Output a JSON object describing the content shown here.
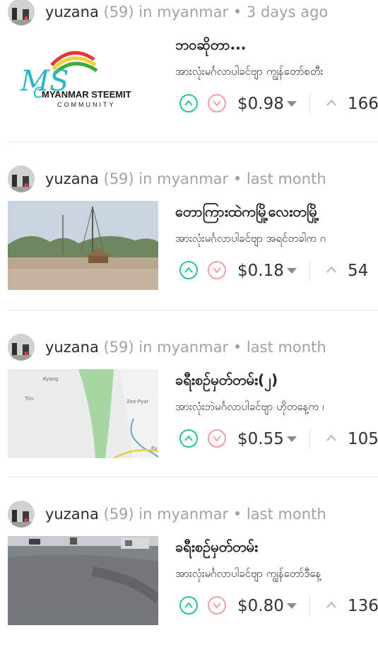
{
  "posts": [
    {
      "author": "yuzana",
      "reputation": "(59)",
      "in": "in",
      "community": "myanmar",
      "time": "3 days ago",
      "title": "ဘဝဆိုတာ...",
      "excerpt": "အားလုံးမင်္ဂလာပါခင်ဗျာ ကျွန်တော်စတီး",
      "payout": "$0.98",
      "votes": "166",
      "thumb_logo": "MYANMAR STEEMIT",
      "thumb_logo_sub": "COMMUNITY"
    },
    {
      "author": "yuzana",
      "reputation": "(59)",
      "in": "in",
      "community": "myanmar",
      "time": "last month",
      "title": "တောကြားထဲကမြို့လေးတမြို့",
      "excerpt": "အားလုံးမင်္ဂလာပါခင်ဗျာ အရင်တခါက ဂ",
      "payout": "$0.18",
      "votes": "54"
    },
    {
      "author": "yuzana",
      "reputation": "(59)",
      "in": "in",
      "community": "myanmar",
      "time": "last month",
      "title": "ခရီးစဉ်မှတ်တမ်း(၂)",
      "excerpt": "အားလုံးဘဲမင်္ဂလာပါခင်ဗျာ ဟိုတနေ့က ၊",
      "payout": "$0.55",
      "votes": "105",
      "map_labels": [
        "Kyang",
        "Tiin",
        "Zee-Pyar",
        "Pu"
      ]
    },
    {
      "author": "yuzana",
      "reputation": "(59)",
      "in": "in",
      "community": "myanmar",
      "time": "last month",
      "title": "ခရီးစဉ်မှတ်တမ်း",
      "excerpt": "အားလုံးမင်္ဂလာပါခင်ဗျာ ကျွန်တော်ဒီနေ့",
      "payout": "$0.80",
      "votes": "136"
    }
  ],
  "separator": " • ",
  "icons": {
    "upvote": "chevron-up-icon",
    "downvote": "chevron-down-icon",
    "payout_menu": "caret-down-icon",
    "votes": "chevron-up-icon"
  },
  "colors": {
    "upvote": "#2bc489",
    "downvote": "#f2a0a0",
    "muted": "#a2a2a2"
  }
}
